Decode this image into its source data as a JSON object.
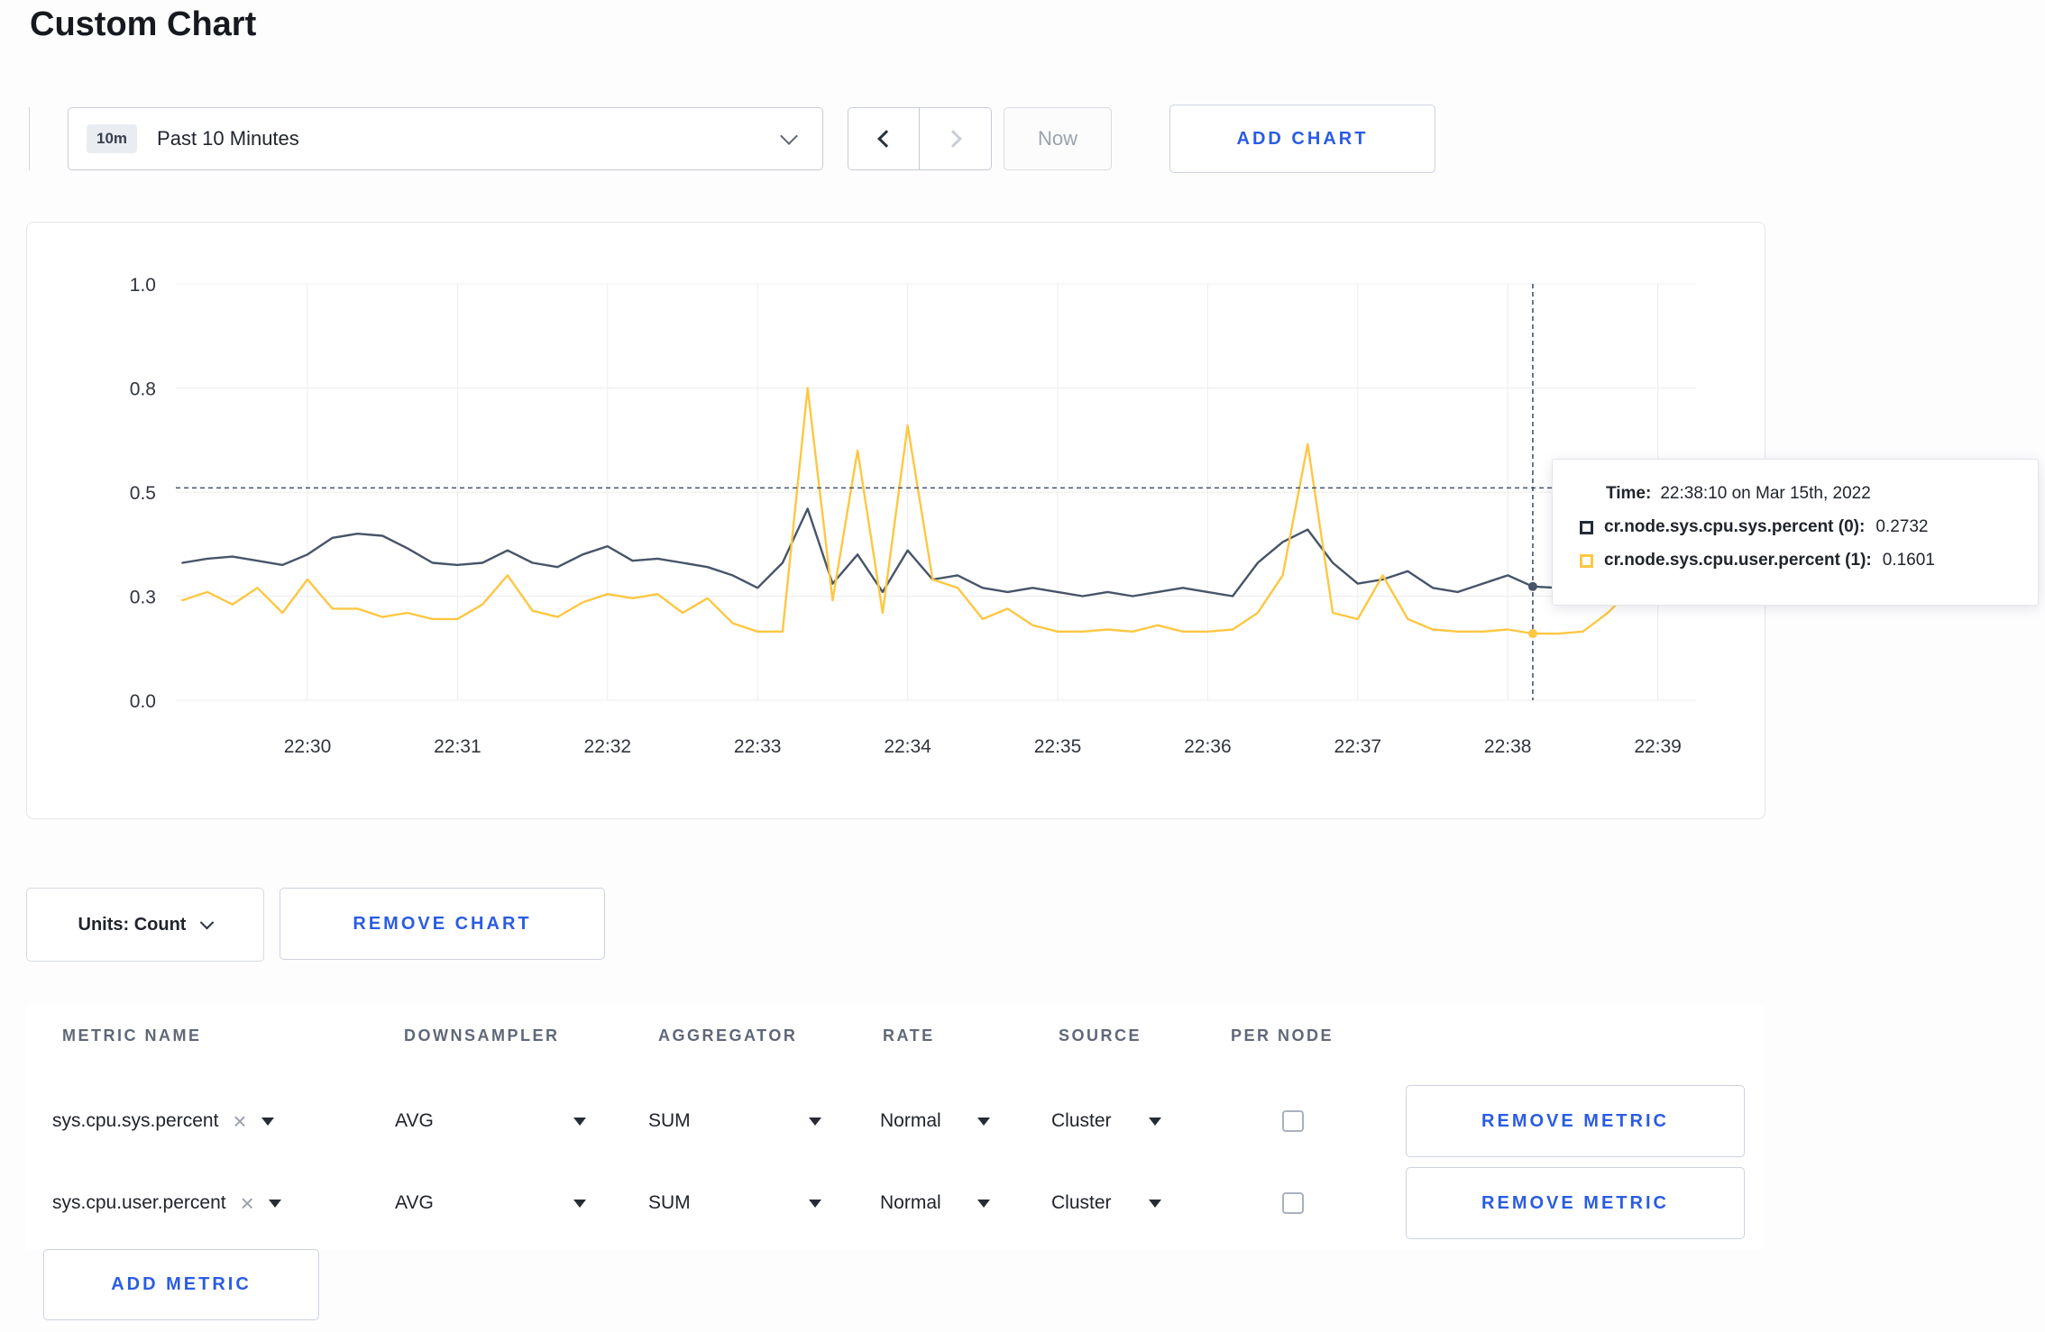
{
  "page": {
    "title": "Custom Chart"
  },
  "toolbar": {
    "time_range": {
      "badge": "10m",
      "label": "Past 10 Minutes"
    },
    "now_label": "Now",
    "add_chart_label": "ADD CHART"
  },
  "chart_controls": {
    "units_label": "Units: Count",
    "remove_chart_label": "REMOVE CHART"
  },
  "tooltip": {
    "time_label": "Time:",
    "time_value": "22:38:10 on Mar 15th, 2022",
    "entries": [
      {
        "name": "cr.node.sys.cpu.sys.percent (0):",
        "value": "0.2732",
        "color": "#242b38"
      },
      {
        "name": "cr.node.sys.cpu.user.percent (1):",
        "value": "0.1601",
        "color": "#fdc742"
      }
    ]
  },
  "metrics_table": {
    "headers": [
      "METRIC NAME",
      "DOWNSAMPLER",
      "AGGREGATOR",
      "RATE",
      "SOURCE",
      "PER NODE"
    ],
    "rows": [
      {
        "metric": "sys.cpu.sys.percent",
        "downsampler": "AVG",
        "aggregator": "SUM",
        "rate": "Normal",
        "source": "Cluster",
        "per_node_checked": false,
        "remove_label": "REMOVE METRIC"
      },
      {
        "metric": "sys.cpu.user.percent",
        "downsampler": "AVG",
        "aggregator": "SUM",
        "rate": "Normal",
        "source": "Cluster",
        "per_node_checked": false,
        "remove_label": "REMOVE METRIC"
      }
    ],
    "add_metric_label": "ADD METRIC"
  },
  "icons": {
    "clear_metric": "×"
  },
  "colors": {
    "accent_blue": "#2a5ce4",
    "grid": "#ececee",
    "crosshair": "#46536b"
  },
  "chart_data": {
    "type": "line",
    "title": "",
    "xlabel": "",
    "ylabel": "",
    "ylim": [
      0,
      1
    ],
    "grid": true,
    "x_tick_labels": [
      "22:30",
      "22:31",
      "22:32",
      "22:33",
      "22:34",
      "22:35",
      "22:36",
      "22:37",
      "22:38",
      "22:39"
    ],
    "y_ticks": [
      {
        "value": 0,
        "label": "0.0"
      },
      {
        "value": 0.25,
        "label": "0.3"
      },
      {
        "value": 0.5,
        "label": "0.5"
      },
      {
        "value": 0.75,
        "label": "0.8"
      },
      {
        "value": 1,
        "label": "1.0"
      }
    ],
    "x_start_sec": -50,
    "x_step_sec": 10,
    "x_tick_interval_sec": 60,
    "series": [
      {
        "name": "cr.node.sys.cpu.sys.percent",
        "color": "#475469",
        "values": [
          0.33,
          0.34,
          0.345,
          0.335,
          0.325,
          0.35,
          0.39,
          0.4,
          0.395,
          0.365,
          0.33,
          0.325,
          0.33,
          0.36,
          0.33,
          0.32,
          0.35,
          0.37,
          0.335,
          0.34,
          0.33,
          0.32,
          0.3,
          0.27,
          0.33,
          0.46,
          0.28,
          0.35,
          0.26,
          0.36,
          0.29,
          0.3,
          0.27,
          0.26,
          0.27,
          0.26,
          0.25,
          0.26,
          0.25,
          0.26,
          0.27,
          0.26,
          0.25,
          0.33,
          0.38,
          0.41,
          0.33,
          0.28,
          0.29,
          0.31,
          0.27,
          0.26,
          0.28,
          0.3,
          0.2732,
          0.27,
          0.29,
          0.28,
          0.29,
          0.28,
          0.29
        ]
      },
      {
        "name": "cr.node.sys.cpu.user.percent",
        "color": "#fdc742",
        "values": [
          0.24,
          0.26,
          0.23,
          0.27,
          0.21,
          0.29,
          0.22,
          0.22,
          0.2,
          0.21,
          0.195,
          0.195,
          0.23,
          0.3,
          0.215,
          0.2,
          0.235,
          0.255,
          0.245,
          0.255,
          0.21,
          0.245,
          0.185,
          0.165,
          0.165,
          0.75,
          0.24,
          0.6,
          0.21,
          0.66,
          0.29,
          0.27,
          0.195,
          0.22,
          0.18,
          0.165,
          0.165,
          0.17,
          0.165,
          0.18,
          0.165,
          0.165,
          0.17,
          0.21,
          0.3,
          0.615,
          0.21,
          0.195,
          0.3,
          0.195,
          0.17,
          0.165,
          0.165,
          0.17,
          0.1601,
          0.16,
          0.165,
          0.21,
          0.27,
          0.28,
          0.24
        ]
      }
    ],
    "crosshair": {
      "time_label": "22:38:10 on Mar 15th, 2022",
      "time_sec": 490,
      "hline_value": 0.51,
      "markers": [
        {
          "series": 0,
          "value": 0.2732
        },
        {
          "series": 1,
          "value": 0.1601
        }
      ]
    }
  }
}
